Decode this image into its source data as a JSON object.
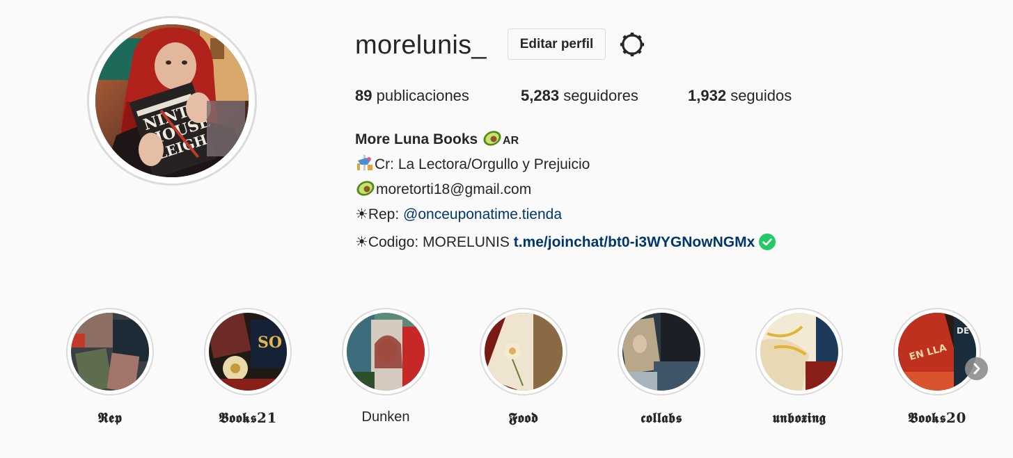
{
  "profile": {
    "username": "morelunis_",
    "edit_button": "Editar perfil",
    "settings_icon": "gear-icon",
    "stats": [
      {
        "count": "89",
        "label": "publicaciones"
      },
      {
        "count": "5,283",
        "label": "seguidores"
      },
      {
        "count": "1,932",
        "label": "seguidos"
      }
    ],
    "bio": {
      "full_name": "More Luna Books",
      "full_name_suffix": "AR",
      "line1": "Cr: La Lectora/Orgullo y Prejuicio",
      "line2": "moretorti18@gmail.com",
      "line3_prefix": "☀Rep: ",
      "line3_mention": "@onceuponatime.tienda",
      "line4_prefix": "☀Codigo: MORELUNIS ",
      "line4_link": "t.me/joinchat/bt0-i3WYGNowNGMx"
    }
  },
  "highlights": [
    {
      "label": "𝕽𝖊𝖕"
    },
    {
      "label": "𝕭𝖔𝖔𝖐𝖘21"
    },
    {
      "label": "Dunken"
    },
    {
      "label": "𝕱𝖔𝖔𝖉"
    },
    {
      "label": "𝖈𝖔𝖑𝖑𝖆𝖇𝖘"
    },
    {
      "label": "𝖚𝖓𝖇𝖔𝖝𝖎𝖓𝖌"
    },
    {
      "label": "𝕭𝖔𝖔𝖐𝖘20"
    }
  ],
  "colors": {
    "link": "#00376b",
    "verified_green": "#26c96a",
    "border": "#dbdbdb"
  }
}
